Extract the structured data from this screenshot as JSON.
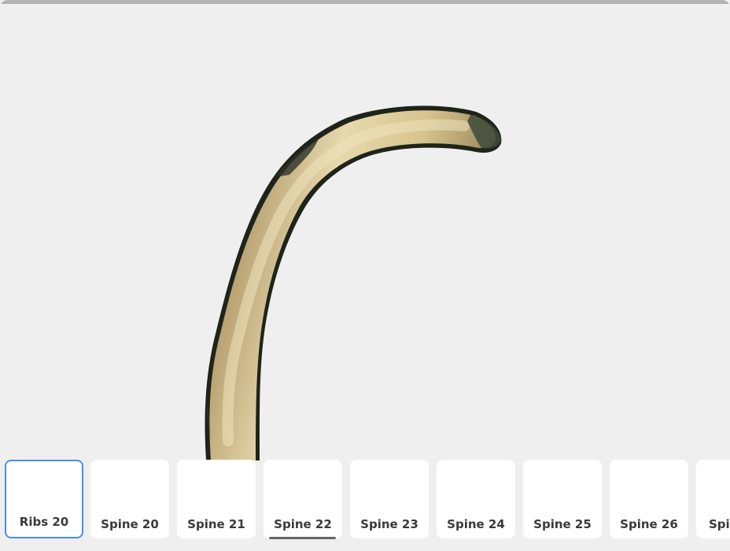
{
  "viewer": {
    "model_name": "rib-bone-3d-model"
  },
  "thumbnails": [
    {
      "label": "Ribs 20",
      "selected": true,
      "hovered": false
    },
    {
      "label": "Spine 20",
      "selected": false,
      "hovered": false
    },
    {
      "label": "Spine 21",
      "selected": false,
      "hovered": false
    },
    {
      "label": "Spine 22",
      "selected": false,
      "hovered": true
    },
    {
      "label": "Spine 23",
      "selected": false,
      "hovered": false
    },
    {
      "label": "Spine 24",
      "selected": false,
      "hovered": false
    },
    {
      "label": "Spine 25",
      "selected": false,
      "hovered": false
    },
    {
      "label": "Spine 26",
      "selected": false,
      "hovered": false
    },
    {
      "label": "Spi",
      "selected": false,
      "hovered": false
    }
  ],
  "colors": {
    "accent": "#4a8ee6",
    "background": "#efefef",
    "bone_light": "#e8dcae",
    "bone_dark": "#2f3a2c"
  }
}
